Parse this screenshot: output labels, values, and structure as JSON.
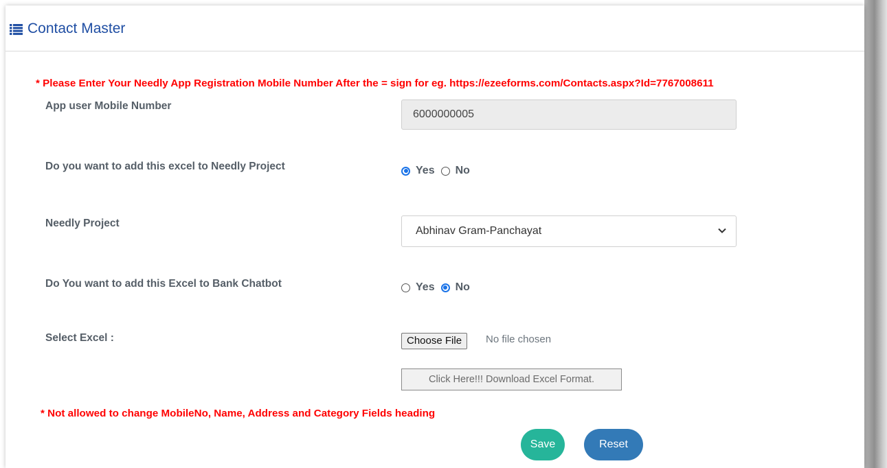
{
  "header": {
    "title": "Contact Master",
    "icon": "list-icon",
    "title_color": "#1f4ea3"
  },
  "notice_top": "* Please Enter Your Needly App Registration Mobile Number After the = sign for eg. https://ezeeforms.com/Contacts.aspx?Id=7767008611",
  "notice_bottom": "* Not allowed to change MobileNo, Name, Address and Category Fields heading",
  "form": {
    "mobile": {
      "label": "App user Mobile Number",
      "value": "6000000005"
    },
    "add_to_project": {
      "label": "Do you want to add this excel to Needly Project",
      "options": [
        "Yes",
        "No"
      ],
      "selected": "Yes"
    },
    "project": {
      "label": "Needly Project",
      "selected": "Abhinav Gram-Panchayat"
    },
    "add_to_bank": {
      "label": "Do You want to add this Excel to Bank Chatbot",
      "options": [
        "Yes",
        "No"
      ],
      "selected": "No"
    },
    "excel": {
      "label": "Select Excel :",
      "button": "Choose File",
      "status": "No file chosen",
      "download": "Click Here!!! Download Excel Format."
    }
  },
  "buttons": {
    "save": "Save",
    "reset": "Reset"
  },
  "colors": {
    "notice": "#ff0000",
    "save": "#26b59a",
    "reset": "#337ab7",
    "radio": "#1a73e8"
  }
}
